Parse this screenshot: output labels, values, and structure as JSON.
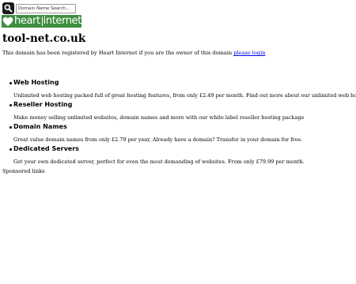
{
  "search": {
    "placeholder": "Domain Name Search..."
  },
  "logo": {
    "part1": "heart",
    "part2": "internet",
    "brand_color": "#3f8d3f"
  },
  "site_title": "tool-net.co.uk",
  "intro": {
    "text": "This domain has been registered by Heart Internet if you are the owner of this domain ",
    "link": "please login"
  },
  "services": [
    {
      "heading": "Web Hosting",
      "desc": "Unlimited web hosting packed full of great hosting features, from only £2.49 per month. Find out more about our unlimited web hosting"
    },
    {
      "heading": "Reseller Hosting",
      "desc": "Make money selling unlimited websites, domain names and more with our white label reseller hosting package"
    },
    {
      "heading": "Domain Names",
      "desc": "Great value domain names from only £2.79 per year, Already have a domain? Transfer in your domain for free."
    },
    {
      "heading": "Dedicated Servers",
      "desc": "Get your own dedicated server, perfect for even the most demanding of websites. From only £79.99 per month."
    }
  ],
  "sponsored": "Sponsored links",
  "icons": {
    "search_button": "search-icon"
  }
}
